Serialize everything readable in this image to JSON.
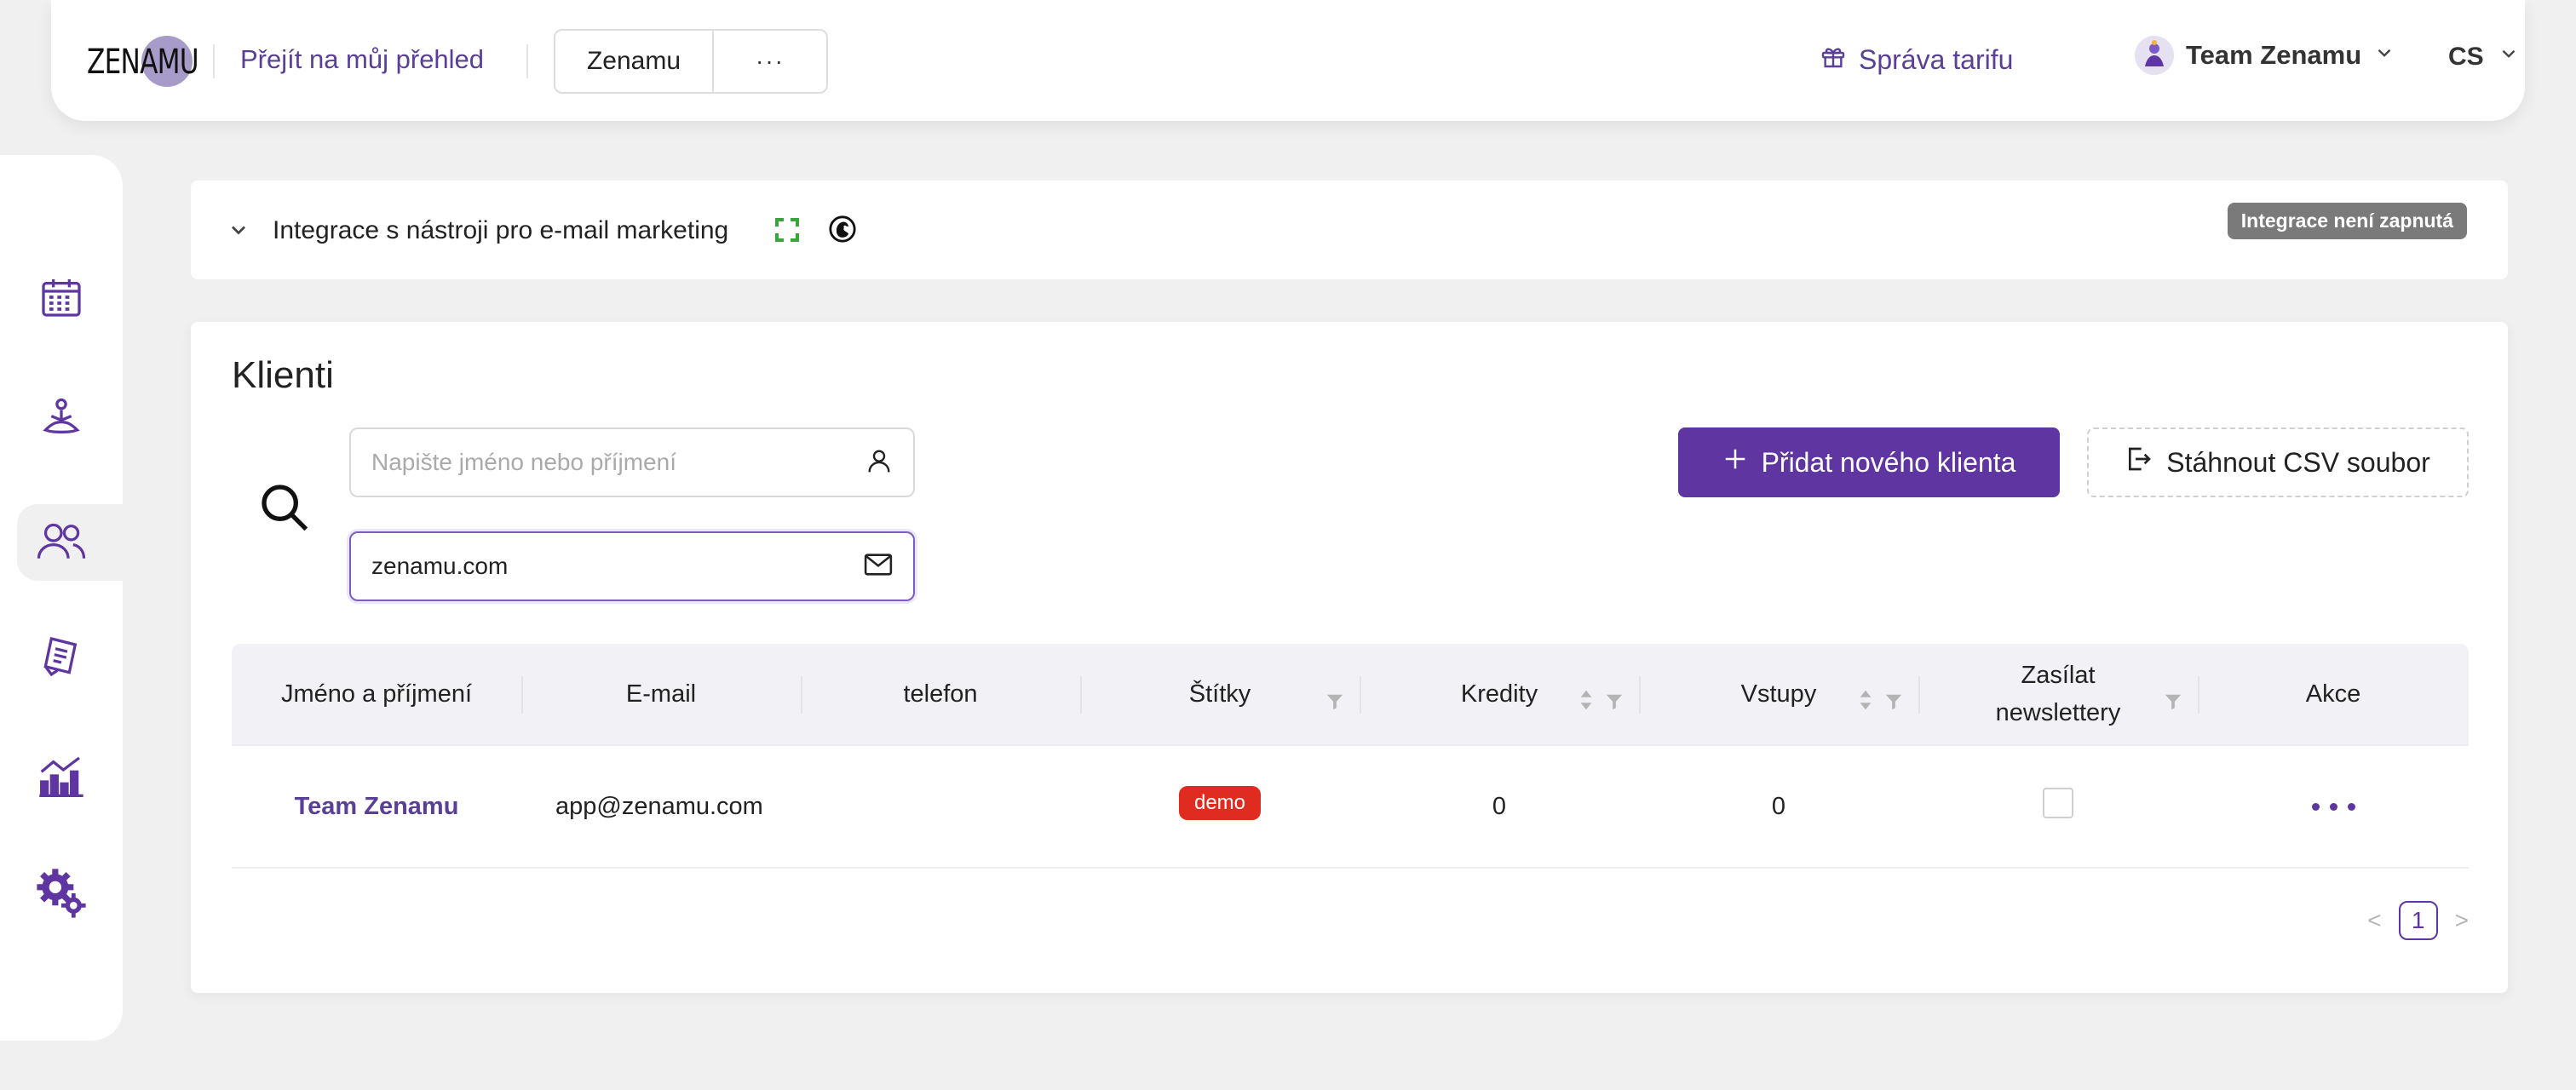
{
  "header": {
    "logo_text": "ZENAMU",
    "dashboard_link": "Přejít na můj přehled",
    "brand_select": "Zenamu",
    "brand_more": "···",
    "tariff_link": "Správa tarifu",
    "team_name": "Team Zenamu",
    "language": "CS"
  },
  "sidebar": {
    "items": [
      {
        "icon": "calendar-icon",
        "active": false
      },
      {
        "icon": "meditation-icon",
        "active": false
      },
      {
        "icon": "users-icon",
        "active": true
      },
      {
        "icon": "receipt-icon",
        "active": false
      },
      {
        "icon": "chart-icon",
        "active": false
      },
      {
        "icon": "settings-icon",
        "active": false
      }
    ]
  },
  "integration": {
    "title": "Integrace s nástroji pro e-mail marketing",
    "status_badge": "Integrace není zapnutá"
  },
  "clients": {
    "title": "Klienti",
    "name_search_placeholder": "Napište jméno nebo příjmení",
    "name_search_value": "",
    "email_search_value": "zenamu.com",
    "add_button": "Přidat nového klienta",
    "csv_button": "Stáhnout CSV soubor",
    "columns": {
      "name": "Jméno a příjmení",
      "email": "E-mail",
      "phone": "telefon",
      "tags": "Štítky",
      "credits": "Kredity",
      "entries": "Vstupy",
      "newsletter": "Zasílat newslettery",
      "actions": "Akce"
    },
    "rows": [
      {
        "name": "Team Zenamu",
        "email": "app@zenamu.com",
        "phone": "",
        "tag": "demo",
        "credits": "0",
        "entries": "0",
        "newsletter": false
      }
    ],
    "pagination": {
      "current_page": "1",
      "prev": "<",
      "next": ">"
    }
  },
  "colors": {
    "accent": "#5e35a1",
    "tag_red": "#e02b20",
    "badge_grey": "#7a7a7a",
    "background": "#f0f0f0"
  }
}
